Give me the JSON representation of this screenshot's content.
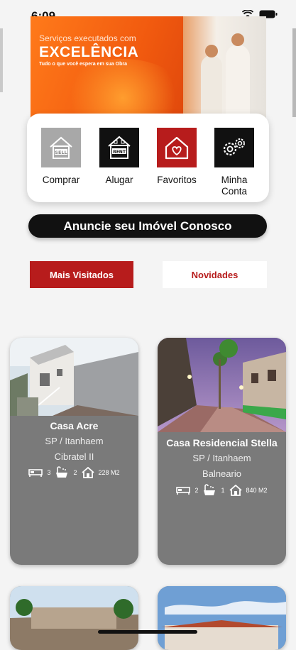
{
  "status": {
    "time": "6:09"
  },
  "banner": {
    "subtitle": "Serviços executados com",
    "title": "EXCELÊNCIA",
    "tagline": "Tudo o que você espera em sua Obra"
  },
  "menu": {
    "items": [
      {
        "label": "Comprar",
        "icon": "sell-house-icon"
      },
      {
        "label": "Alugar",
        "icon": "rent-house-icon"
      },
      {
        "label": "Favoritos",
        "icon": "heart-house-icon"
      },
      {
        "label": "Minha Conta",
        "icon": "gears-icon"
      }
    ]
  },
  "cta": {
    "label": "Anuncie seu Imóvel Conosco"
  },
  "tabs": [
    {
      "label": "Mais Visitados",
      "active": true
    },
    {
      "label": "Novidades",
      "active": false
    }
  ],
  "properties": [
    {
      "title": "Casa Acre",
      "location": "SP / Itanhaem",
      "neighborhood": "Cibratel II",
      "beds": "3",
      "baths": "2",
      "area": "228 M2"
    },
    {
      "title": "Casa Residencial Stella",
      "location": "SP / Itanhaem",
      "neighborhood": "Balneario",
      "beds": "2",
      "baths": "1",
      "area": "840 M2"
    }
  ],
  "colors": {
    "accent": "#b71c1c",
    "card": "#7a7a7a",
    "dark": "#111111"
  }
}
